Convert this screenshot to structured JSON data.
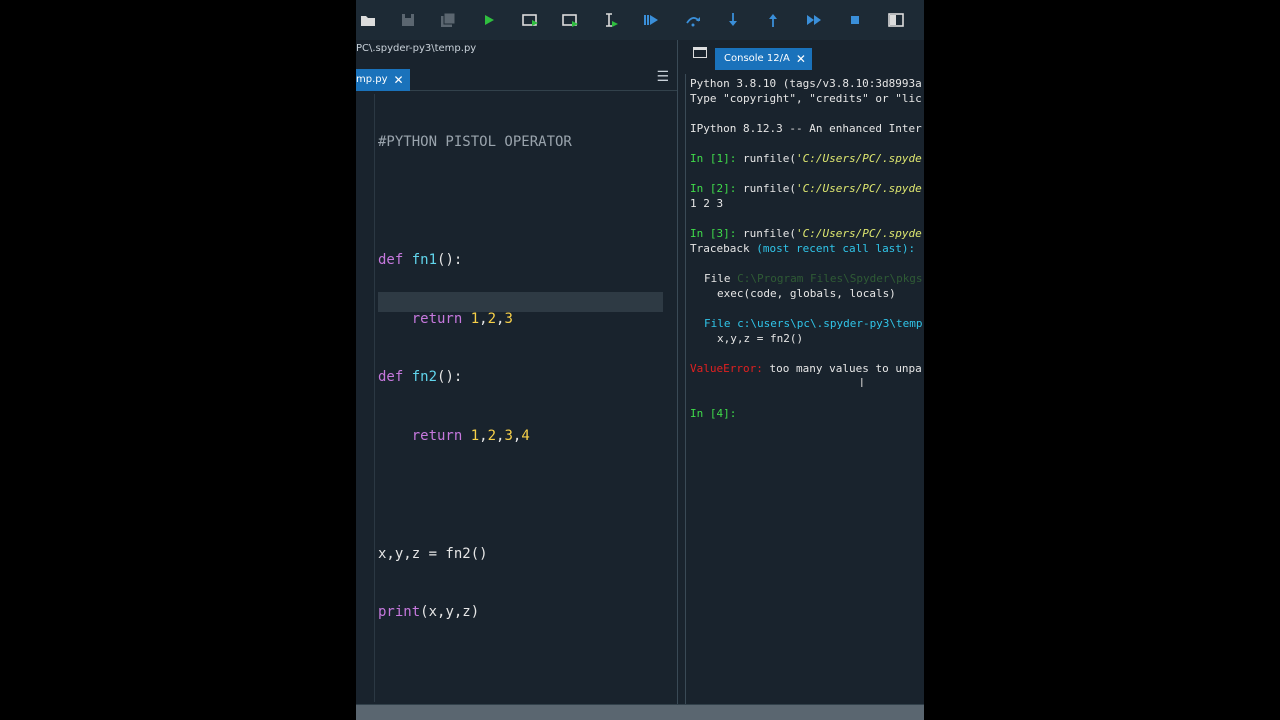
{
  "toolbar": {
    "icons": [
      "open-folder-icon",
      "save-icon",
      "save-all-icon",
      "run-icon",
      "run-cell-icon",
      "run-cell-advance-icon",
      "run-selection-icon",
      "debug-icon",
      "step-over-icon",
      "step-into-icon",
      "step-return-icon",
      "continue-icon",
      "stop-icon",
      "maximize-pane-icon"
    ],
    "colors": {
      "accent": "#3a8fd9",
      "run": "#2fbf3f"
    }
  },
  "editor": {
    "path": "PC\\.spyder-py3\\temp.py",
    "tab_label": "mp.py",
    "lines": [
      "#PYTHON PISTOL OPERATOR",
      "",
      "def fn1():",
      "    return 1,2,3",
      "def fn2():",
      "    return 1,2,3,4",
      "",
      "x,y,z = fn2()",
      "print(x,y,z)"
    ]
  },
  "console": {
    "tab_label": "Console 12/A",
    "line1": "Python 3.8.10 (tags/v3.8.10:3d8993a",
    "line2": "Type \"copyright\", \"credits\" or \"lic",
    "line3": "IPython 8.12.3 -- An enhanced Inter",
    "in1": "In [1]:",
    "in2": "In [2]:",
    "in3": "In [3]:",
    "in4": "In [4]:",
    "runfile": "runfile(",
    "runfile_arg": "'C:/Users/PC/.spyde",
    "out2": "1 2 3",
    "traceback": "Traceback",
    "traceback_rest": "(most recent call last):",
    "file_word": "File",
    "file1_path": "C:\\Program Files\\Spyder\\pkgs",
    "exec_line": "exec(code, globals, locals)",
    "file2": "File c:\\users\\pc\\.spyder-py3\\temp",
    "xyz_line": "x,y,z = fn2()",
    "error_name": "ValueError:",
    "error_msg": "too many values to unpa"
  }
}
